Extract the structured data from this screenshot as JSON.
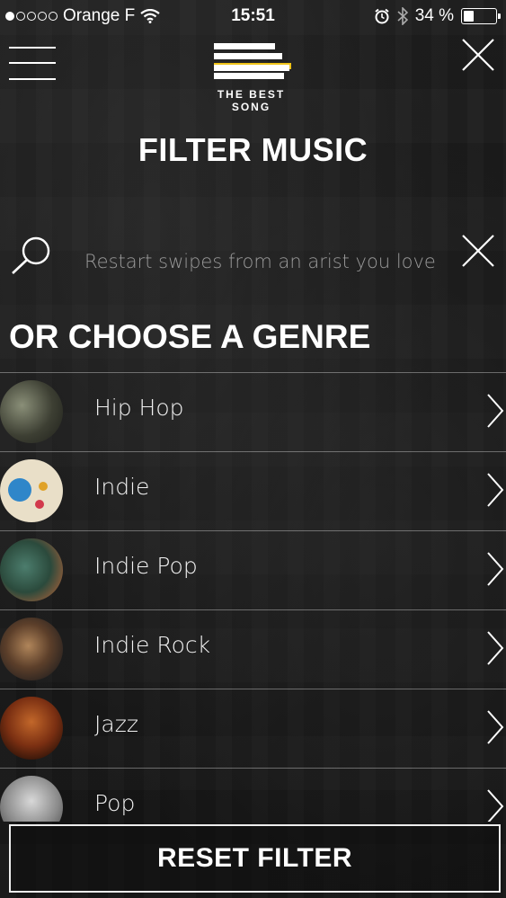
{
  "status_bar": {
    "carrier": "Orange F",
    "time": "15:51",
    "battery_percent": "34 %",
    "battery_level": 0.34,
    "signal_bars_filled": 1
  },
  "header": {
    "logo_line1": "THE BEST",
    "logo_line2": "SONG",
    "title": "FILTER MUSIC"
  },
  "search": {
    "placeholder": "Restart swipes from an arist you love",
    "value": ""
  },
  "genres": {
    "heading": "OR CHOOSE A GENRE",
    "items": [
      {
        "label": "Hip Hop"
      },
      {
        "label": "Indie"
      },
      {
        "label": "Indie Pop"
      },
      {
        "label": "Indie Rock"
      },
      {
        "label": "Jazz"
      },
      {
        "label": "Pop"
      }
    ]
  },
  "footer": {
    "reset_label": "RESET FILTER"
  },
  "icons": {
    "menu": "hamburger-icon",
    "close": "close-icon",
    "search": "search-icon",
    "clear": "clear-icon",
    "chevron": "chevron-right-icon"
  },
  "colors": {
    "background": "#1c1c1c",
    "text": "#ffffff",
    "placeholder": "#9a9a9a"
  }
}
